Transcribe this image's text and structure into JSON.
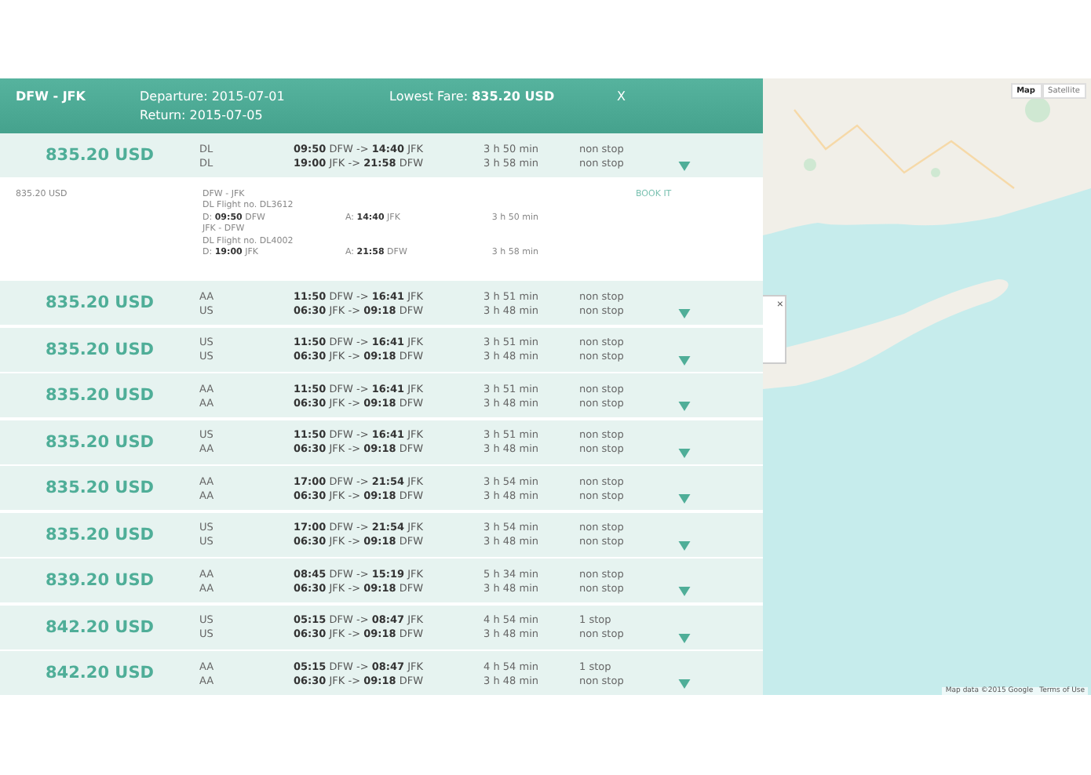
{
  "header": {
    "route": "DFW - JFK",
    "departure": "Departure: 2015-07-01",
    "return": "Return: 2015-07-05",
    "lowest_fare": "Lowest Fare: **835.20 USD**",
    "close": "X"
  },
  "flights": [
    {
      "price": "835.20 USD",
      "airlines": [
        "DL",
        "DL"
      ],
      "legs": [
        "**09:50** DFW -> **14:40** JFK",
        "**19:00** JFK -> **21:58** DFW"
      ],
      "durations": [
        "3 h 50 min",
        "3 h 58 min"
      ],
      "stops": [
        "non stop",
        "non stop"
      ],
      "details": {
        "price": "835.20 USD",
        "book": "BOOK IT",
        "legs": [
          {
            "route": "DFW - JFK",
            "flight": "DL Flight no. DL3612",
            "dep": "D: **09:50** DFW",
            "arr": "A: **14:40** JFK",
            "duration": "3 h 50 min"
          },
          {
            "route": "JFK - DFW",
            "flight": "DL Flight no. DL4002",
            "dep": "D: **19:00** JFK",
            "arr": "A: **21:58** DFW",
            "duration": "3 h 58 min"
          }
        ]
      }
    },
    {
      "price": "835.20 USD",
      "airlines": [
        "AA",
        "US"
      ],
      "legs": [
        "**11:50** DFW -> **16:41** JFK",
        "**06:30** JFK -> **09:18** DFW"
      ],
      "durations": [
        "3 h 51 min",
        "3 h 48 min"
      ],
      "stops": [
        "non stop",
        "non stop"
      ]
    },
    {
      "price": "835.20 USD",
      "airlines": [
        "US",
        "US"
      ],
      "legs": [
        "**11:50** DFW -> **16:41** JFK",
        "**06:30** JFK -> **09:18** DFW"
      ],
      "durations": [
        "3 h 51 min",
        "3 h 48 min"
      ],
      "stops": [
        "non stop",
        "non stop"
      ]
    },
    {
      "price": "835.20 USD",
      "airlines": [
        "AA",
        "AA"
      ],
      "legs": [
        "**11:50** DFW -> **16:41** JFK",
        "**06:30** JFK -> **09:18** DFW"
      ],
      "durations": [
        "3 h 51 min",
        "3 h 48 min"
      ],
      "stops": [
        "non stop",
        "non stop"
      ]
    },
    {
      "price": "835.20 USD",
      "airlines": [
        "US",
        "AA"
      ],
      "legs": [
        "**11:50** DFW -> **16:41** JFK",
        "**06:30** JFK -> **09:18** DFW"
      ],
      "durations": [
        "3 h 51 min",
        "3 h 48 min"
      ],
      "stops": [
        "non stop",
        "non stop"
      ]
    },
    {
      "price": "835.20 USD",
      "airlines": [
        "AA",
        "AA"
      ],
      "legs": [
        "**17:00** DFW -> **21:54** JFK",
        "**06:30** JFK -> **09:18** DFW"
      ],
      "durations": [
        "3 h 54 min",
        "3 h 48 min"
      ],
      "stops": [
        "non stop",
        "non stop"
      ]
    },
    {
      "price": "835.20 USD",
      "airlines": [
        "US",
        "US"
      ],
      "legs": [
        "**17:00** DFW -> **21:54** JFK",
        "**06:30** JFK -> **09:18** DFW"
      ],
      "durations": [
        "3 h 54 min",
        "3 h 48 min"
      ],
      "stops": [
        "non stop",
        "non stop"
      ]
    },
    {
      "price": "839.20 USD",
      "airlines": [
        "AA",
        "AA"
      ],
      "legs": [
        "**08:45** DFW -> **15:19** JFK",
        "**06:30** JFK -> **09:18** DFW"
      ],
      "durations": [
        "5 h 34 min",
        "3 h 48 min"
      ],
      "stops": [
        "non stop",
        "non stop"
      ]
    },
    {
      "price": "842.20 USD",
      "airlines": [
        "US",
        "US"
      ],
      "legs": [
        "**05:15** DFW -> **08:47** JFK",
        "**06:30** JFK -> **09:18** DFW"
      ],
      "durations": [
        "4 h 54 min",
        "3 h 48 min"
      ],
      "stops": [
        "1 stop",
        "non stop"
      ]
    },
    {
      "price": "842.20 USD",
      "airlines": [
        "AA",
        "AA"
      ],
      "legs": [
        "**05:15** DFW -> **08:47** JFK",
        "**06:30** JFK -> **09:18** DFW"
      ],
      "durations": [
        "4 h 54 min",
        "3 h 48 min"
      ],
      "stops": [
        "1 stop",
        "non stop"
      ]
    }
  ],
  "map": {
    "types": [
      {
        "label": "Map",
        "selected": true
      },
      {
        "label": "Satellite",
        "selected": false
      }
    ],
    "popup_close": "×",
    "attribution": "Map data ©2015 Google",
    "terms": "Terms of Use"
  }
}
